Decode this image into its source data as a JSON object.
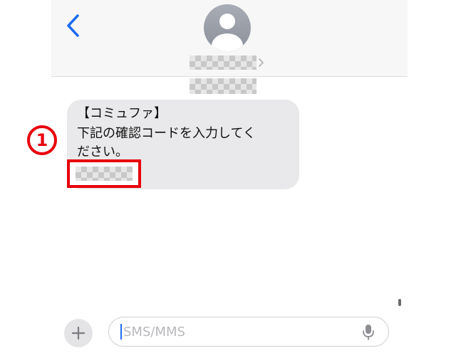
{
  "contact": {
    "avatar_icon": "person-silhouette-icon",
    "name_masked": true
  },
  "message": {
    "line1": "【コミュファ】",
    "line2": "下記の確認コードを入力してく",
    "line3": "ださい。",
    "code_masked": true
  },
  "annotation": {
    "marker": "1"
  },
  "composer": {
    "placeholder": "SMS/MMS"
  },
  "colors": {
    "accent": "#1e6cf0",
    "highlight": "#e8000b",
    "bubble": "#e9e9eb"
  }
}
